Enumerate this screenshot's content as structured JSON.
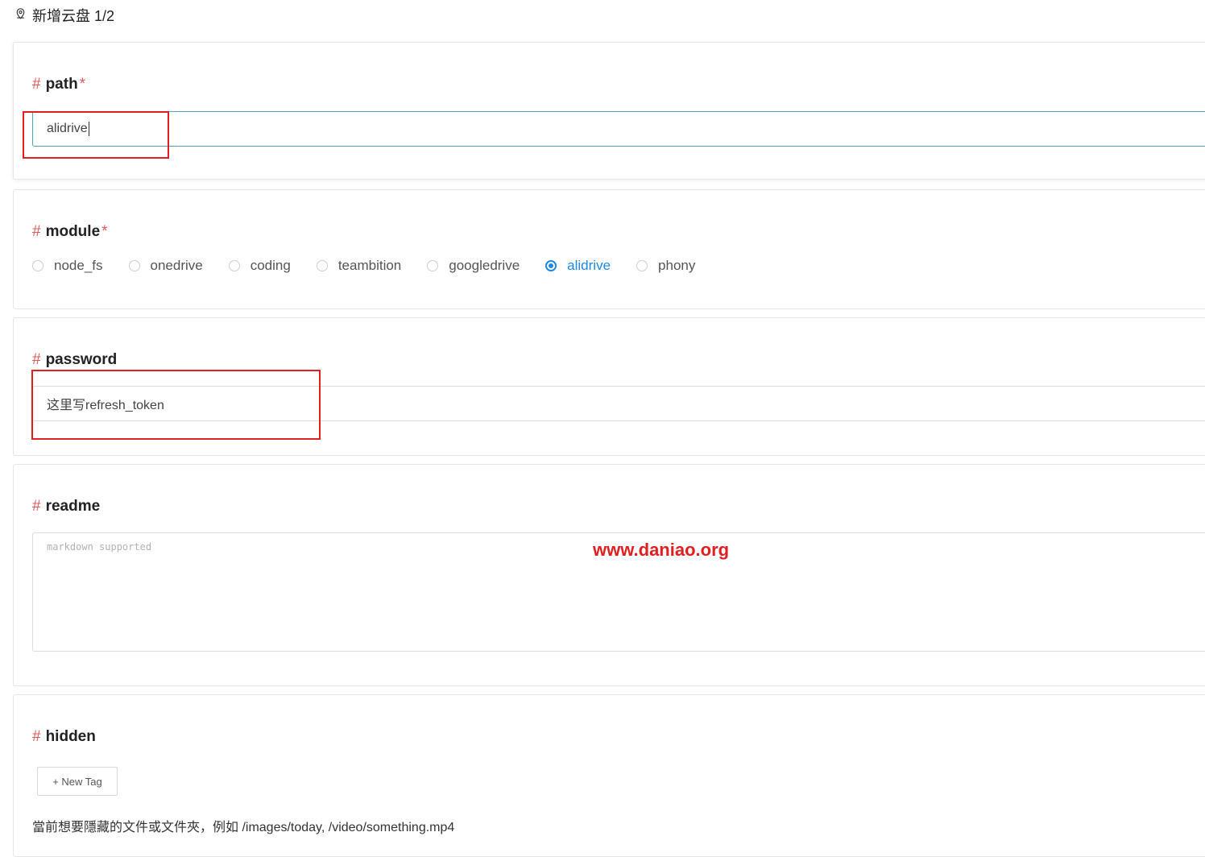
{
  "header": {
    "icon": "map-pin-icon",
    "title": "新增云盘 1/2"
  },
  "path": {
    "label": "path",
    "required_mark": "*",
    "value": "alidrive"
  },
  "module": {
    "label": "module",
    "required_mark": "*",
    "options": [
      "node_fs",
      "onedrive",
      "coding",
      "teambition",
      "googledrive",
      "alidrive",
      "phony"
    ],
    "selected": "alidrive"
  },
  "password": {
    "label": "password",
    "value": "这里写refresh_token"
  },
  "readme": {
    "label": "readme",
    "placeholder": "markdown supported"
  },
  "hidden": {
    "label": "hidden",
    "new_tag_label": "+ New Tag",
    "hint": "當前想要隱藏的文件或文件夾，例如 /images/today, /video/something.mp4"
  },
  "watermark": "www.daniao.org",
  "colors": {
    "accent": "#1e88e5",
    "hash": "#e05a5a",
    "annotation": "#e02020",
    "focus_border": "#4aa7bf"
  },
  "hash_symbol": "#"
}
